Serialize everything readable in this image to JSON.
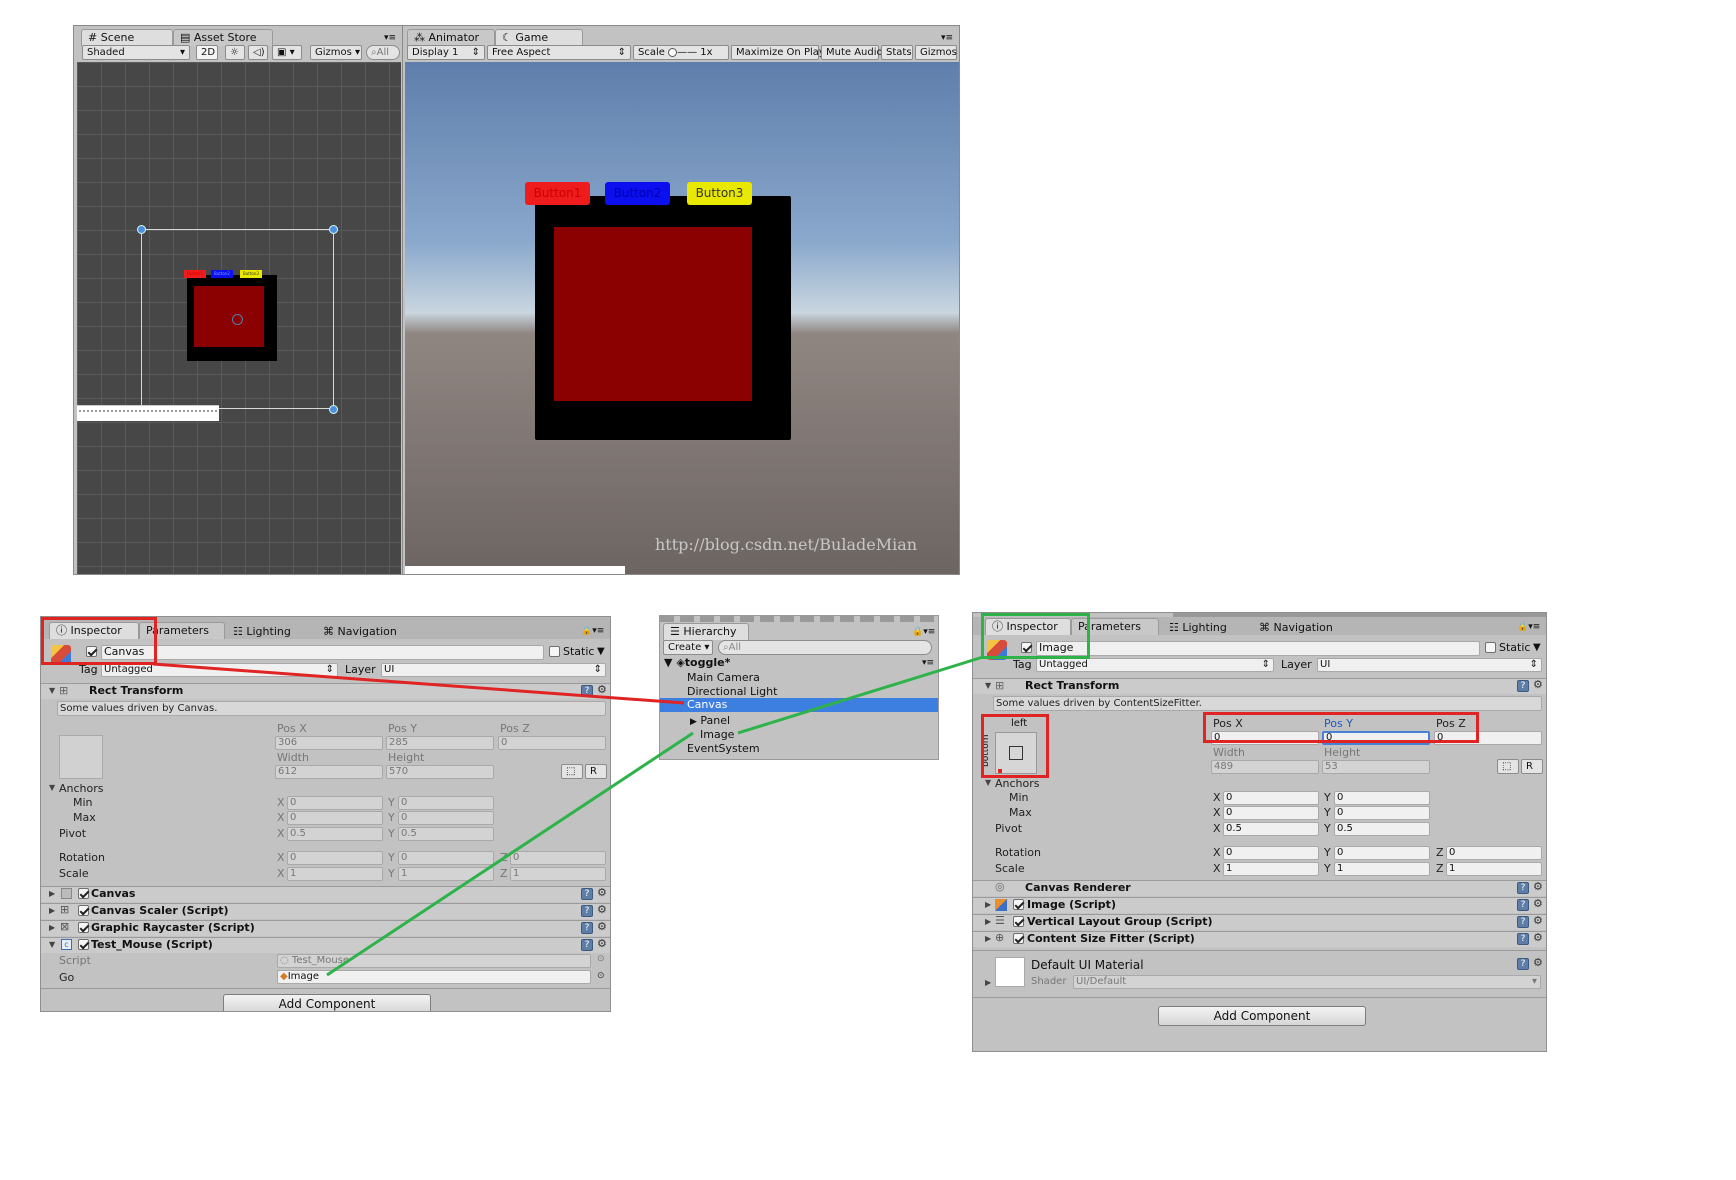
{
  "scene_view": {
    "tabs": [
      "Scene",
      "Asset Store"
    ],
    "shading_mode": "Shaded",
    "btn_2d": "2D",
    "gizmos_label": "Gizmos",
    "search_placeholder": "All",
    "canvas_button_labels": [
      "Button1",
      "Button2",
      "Button3"
    ],
    "colors": {
      "background": "#474747",
      "grid": "#5a5a5a"
    }
  },
  "game_view": {
    "tabs": [
      "Animator",
      "Game"
    ],
    "display": "Display 1",
    "aspect": "Free Aspect",
    "scale_label": "Scale",
    "scale_value": "1x",
    "maximize_on_play": "Maximize On Play",
    "mute_audio": "Mute Audio",
    "stats": "Stats",
    "gizmos": "Gizmos",
    "buttons": [
      {
        "label": "Button1",
        "bg": "#ee1c1c",
        "fg": "#c80000"
      },
      {
        "label": "Button2",
        "bg": "#0c10ee",
        "fg": "#0000b0"
      },
      {
        "label": "Button3",
        "bg": "#e8e800",
        "fg": "#333333"
      }
    ],
    "watermark": "http://blog.csdn.net/BuladeMian",
    "colors": {
      "panel": "#000000",
      "image": "#8b0000",
      "sky": "#6a88b2",
      "ground": "#6d6562"
    }
  },
  "inspector_left": {
    "tabs": [
      "Inspector",
      "Parameters",
      "Lighting",
      "Navigation"
    ],
    "object_name": "Canvas",
    "static_label": "Static",
    "tag_label": "Tag",
    "tag_value": "Untagged",
    "layer_label": "Layer",
    "layer_value": "UI",
    "rect_transform": "Rect Transform",
    "note": "Some values driven by Canvas.",
    "pos_x_label": "Pos X",
    "pos_y_label": "Pos Y",
    "pos_z_label": "Pos Z",
    "pos_x": "306",
    "pos_y": "285",
    "pos_z": "0",
    "width_label": "Width",
    "height_label": "Height",
    "width": "612",
    "height": "570",
    "r_button": "R",
    "anchors": "Anchors",
    "min": "Min",
    "max": "Max",
    "pivot": "Pivot",
    "rotation": "Rotation",
    "scale": "Scale",
    "axis_x": "X",
    "axis_y": "Y",
    "axis_z": "Z",
    "anchor_min_x": "0",
    "anchor_min_y": "0",
    "anchor_max_x": "0",
    "anchor_max_y": "0",
    "pivot_x": "0.5",
    "pivot_y": "0.5",
    "rot_x": "0",
    "rot_y": "0",
    "rot_z": "0",
    "scale_x": "1",
    "scale_y": "1",
    "scale_z": "1",
    "components": [
      "Canvas",
      "Canvas Scaler (Script)",
      "Graphic Raycaster (Script)",
      "Test_Mouse (Script)"
    ],
    "script_label": "Script",
    "script_value": "Test_Mouse",
    "go_label": "Go",
    "go_value": "Image",
    "add_component": "Add Component"
  },
  "hierarchy": {
    "tab": "Hierarchy",
    "create": "Create",
    "search_placeholder": "All",
    "scene_name": "toggle*",
    "items": [
      "Main Camera",
      "Directional Light",
      "Canvas",
      "Panel",
      "Image",
      "EventSystem"
    ]
  },
  "inspector_right": {
    "tabs": [
      "Inspector",
      "Parameters",
      "Lighting",
      "Navigation"
    ],
    "object_name": "Image",
    "static_label": "Static",
    "tag_label": "Tag",
    "tag_value": "Untagged",
    "layer_label": "Layer",
    "layer_value": "UI",
    "rect_transform": "Rect Transform",
    "note": "Some values driven by ContentSizeFitter.",
    "anchor_left": "left",
    "anchor_bottom": "bottom",
    "pos_x_label": "Pos X",
    "pos_y_label": "Pos Y",
    "pos_z_label": "Pos Z",
    "pos_x": "0",
    "pos_y": "0",
    "pos_z": "0",
    "width_label": "Width",
    "height_label": "Height",
    "width": "489",
    "height": "53",
    "r_button": "R",
    "anchors": "Anchors",
    "min": "Min",
    "max": "Max",
    "pivot": "Pivot",
    "rotation": "Rotation",
    "scale": "Scale",
    "axis_x": "X",
    "axis_y": "Y",
    "axis_z": "Z",
    "anchor_min_x": "0",
    "anchor_min_y": "0",
    "anchor_max_x": "0",
    "anchor_max_y": "0",
    "pivot_x": "0.5",
    "pivot_y": "0.5",
    "rot_x": "0",
    "rot_y": "0",
    "rot_z": "0",
    "scale_x": "1",
    "scale_y": "1",
    "scale_z": "1",
    "components": [
      "Canvas Renderer",
      "Image (Script)",
      "Vertical Layout Group (Script)",
      "Content Size Fitter (Script)"
    ],
    "material_name": "Default UI Material",
    "shader_label": "Shader",
    "shader_value": "UI/Default",
    "add_component": "Add Component"
  },
  "annotation_colors": {
    "red": "#e02424",
    "green": "#2eb24a"
  }
}
